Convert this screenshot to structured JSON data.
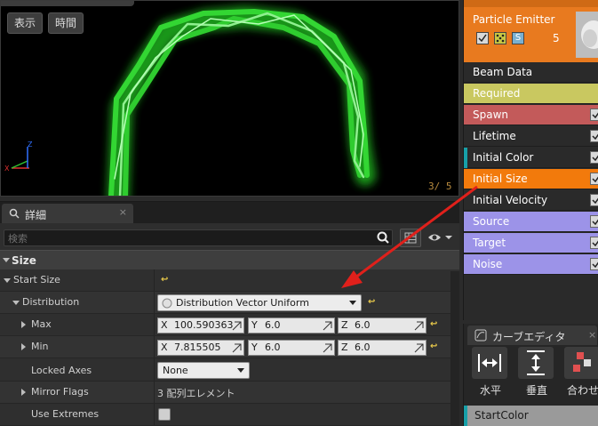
{
  "viewport": {
    "show_button": "表示",
    "time_button": "時間",
    "counter": "3/  5"
  },
  "details": {
    "tab_label": "詳細",
    "tab_close": "×",
    "search_placeholder": "検索",
    "section_title": "Size",
    "start_size_label": "Start Size",
    "distribution_label": "Distribution",
    "distribution_value": "Distribution Vector Uniform",
    "max": {
      "label": "Max",
      "x": "100.590363",
      "y": "6.0",
      "z": "6.0"
    },
    "min": {
      "label": "Min",
      "x": "7.815505",
      "y": "6.0",
      "z": "6.0"
    },
    "axis_x": "X",
    "axis_y": "Y",
    "axis_z": "Z",
    "locked_axes_label": "Locked Axes",
    "locked_axes_value": "None",
    "mirror_flags_label": "Mirror Flags",
    "mirror_flags_value": "3 配列エレメント",
    "use_extremes_label": "Use Extremes"
  },
  "emitter": {
    "name": "Particle Emitter",
    "count": "5",
    "icon_s": "S",
    "modules": [
      {
        "label": "Beam Data",
        "bg": "#2a2a2a",
        "fg": "#ffffff",
        "check": false
      },
      {
        "label": "Required",
        "bg": "#c9c860",
        "fg": "#ffffff",
        "check": false
      },
      {
        "label": "Spawn",
        "bg": "#c35a5a",
        "fg": "#ffffff",
        "check": true
      },
      {
        "label": "Lifetime",
        "bg": "#2a2a2a",
        "fg": "#ffffff",
        "check": true
      },
      {
        "label": "Initial Color",
        "bg": "#2a2a2a",
        "fg": "#ffffff",
        "check": true
      },
      {
        "label": "Initial Size",
        "bg": "#f27a0c",
        "fg": "#ffffff",
        "check": true
      },
      {
        "label": "Initial Velocity",
        "bg": "#2a2a2a",
        "fg": "#ffffff",
        "check": true
      },
      {
        "label": "Source",
        "bg": "#9c93e8",
        "fg": "#ffffff",
        "check": true
      },
      {
        "label": "Target",
        "bg": "#9c93e8",
        "fg": "#ffffff",
        "check": true
      },
      {
        "label": "Noise",
        "bg": "#9c93e8",
        "fg": "#ffffff",
        "check": true
      }
    ]
  },
  "curve_editor": {
    "tab_label": "カーブエディタ",
    "tab_close": "×",
    "horizontal_label": "水平",
    "vertical_label": "垂直",
    "fit_label": "合わせ",
    "track_label": "StartColor"
  },
  "colors": {
    "beam_green": "#39d639",
    "annotation_red": "#e0201b",
    "selected_orange": "#f27a0c",
    "teal_marker": "#17a0a8"
  },
  "icons": [
    "search-icon",
    "grid-view-icon",
    "eye-icon",
    "reset-arrow-icon",
    "expand-caret-icon",
    "curve-editor-icon"
  ]
}
